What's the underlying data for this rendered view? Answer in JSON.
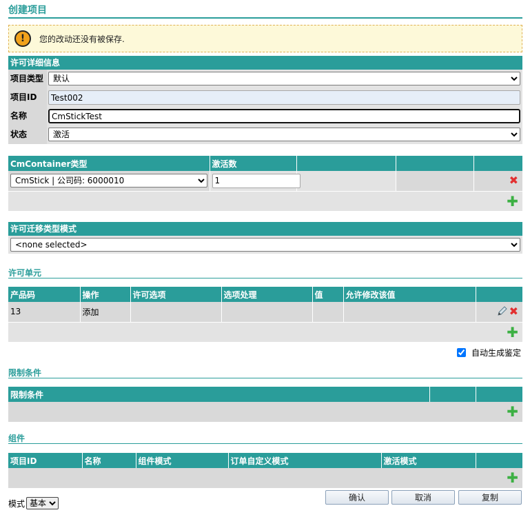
{
  "page_title": "创建项目",
  "warning": {
    "text": "您的改动还没有被保存."
  },
  "license_details": {
    "header": "许可详细信息",
    "fields": [
      {
        "label": "项目类型",
        "value": "默认"
      },
      {
        "label": "项目ID",
        "value": "Test002"
      },
      {
        "label": "名称",
        "value": "CmStickTest"
      },
      {
        "label": "状态",
        "value": "激活"
      }
    ]
  },
  "container": {
    "headers": [
      "CmContainer类型",
      "激活数",
      "",
      "",
      ""
    ],
    "row": {
      "type": "CmStick | 公司码: 6000010",
      "count": "1"
    }
  },
  "transfer": {
    "header": "许可迁移类型模式",
    "value": "<none selected>"
  },
  "license_units": {
    "title": "许可单元",
    "headers": [
      "产品码",
      "操作",
      "许可选项",
      "选项处理",
      "值",
      "允许修改该值",
      ""
    ],
    "rows": [
      {
        "product_code": "13",
        "action": "添加",
        "option": "",
        "handling": "",
        "value": "",
        "allow_modify": ""
      }
    ],
    "auto_label": "自动生成鉴定",
    "auto_checked": true
  },
  "restrictions": {
    "title": "限制条件",
    "headers": [
      "限制条件",
      "",
      ""
    ]
  },
  "components": {
    "title": "组件",
    "headers": [
      "项目ID",
      "名称",
      "组件模式",
      "订单自定义模式",
      "激活模式",
      ""
    ]
  },
  "footer": {
    "mode_label": "模式",
    "mode_value": "基本",
    "confirm": "确认",
    "cancel": "取消",
    "copy": "复制"
  },
  "colors": {
    "accent": "#2a9d9a",
    "warning_bg": "#fdf9d9",
    "delete": "#e23030",
    "add": "#3cb043"
  }
}
